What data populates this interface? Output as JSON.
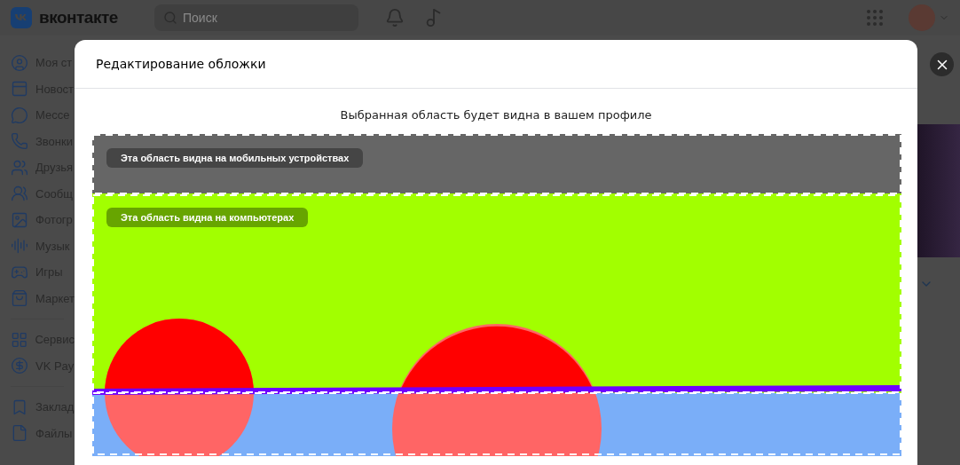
{
  "header": {
    "logo": "вконтакте",
    "search": {
      "placeholder": "Поиск"
    }
  },
  "sidebar": {
    "groups": [
      [
        {
          "label": "Моя ст"
        },
        {
          "label": "Новост"
        },
        {
          "label": "Мессе"
        },
        {
          "label": "Звонки"
        },
        {
          "label": "Друзья"
        },
        {
          "label": "Сообщ"
        },
        {
          "label": "Фотогр"
        },
        {
          "label": "Музык"
        },
        {
          "label": "Игры"
        },
        {
          "label": "Маркет"
        }
      ],
      [
        {
          "label": "Сервис"
        },
        {
          "label": "VK Pay"
        }
      ],
      [
        {
          "label": "Заклад"
        },
        {
          "label": "Файлы"
        }
      ]
    ]
  },
  "modal": {
    "title": "Редактирование обложки",
    "hint": "Выбранная область будет видна в вашем профиле",
    "regions": [
      {
        "kind": "mobile",
        "label": "Эта область видна на мобильных устройствах"
      },
      {
        "kind": "desktop",
        "label": "Эта область видна на компьютерах"
      }
    ]
  }
}
